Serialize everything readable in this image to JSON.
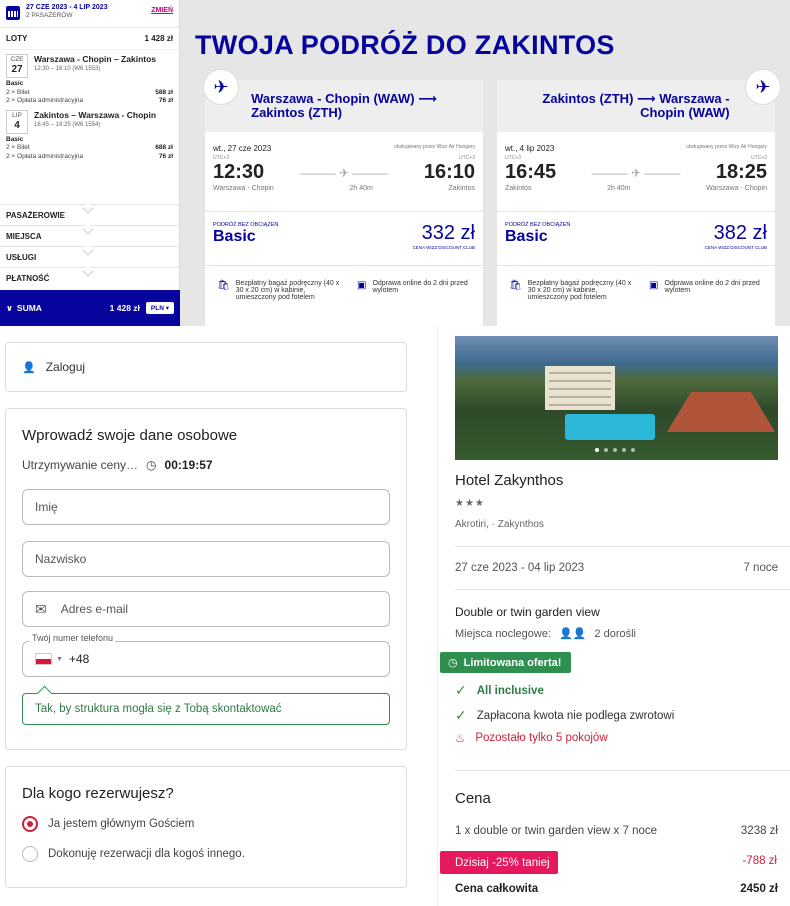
{
  "flight_summary": {
    "dates": "27 CZE 2023 - 4 LIP 2023",
    "passengers": "2 PASAŻERÓW",
    "change_label": "ZMIEŃ",
    "flights_label": "LOTY",
    "flights_total": "1 428 zł",
    "outbound": {
      "month": "CZE",
      "day": "27",
      "route": "Warszawa - Chopin – Zakintos",
      "time": "12:30 – 16:10 (W6 1553)",
      "fare_name": "Basic",
      "lines": [
        {
          "label": "2 × Bilet",
          "price": "588 zł"
        },
        {
          "label": "2 × Opłata administracyjna",
          "price": "76 zł"
        }
      ]
    },
    "inbound": {
      "month": "LIP",
      "day": "4",
      "route": "Zakintos – Warszawa - Chopin",
      "time": "16:45 – 18:25 (W6 1554)",
      "fare_name": "Basic",
      "lines": [
        {
          "label": "2 × Bilet",
          "price": "688 zł"
        },
        {
          "label": "2 × Opłata administracyjna",
          "price": "76 zł"
        }
      ]
    },
    "sections": [
      "PASAŻEROWIE",
      "MIEJSCA",
      "USŁUGI",
      "PŁATNOŚĆ"
    ],
    "sum_label": "SUMA",
    "sum_value": "1 428 zł",
    "currency": "PLN"
  },
  "trip_title": "TWOJA PODRÓŻ DO ZAKINTOS",
  "cards": [
    {
      "route_line1": "Warszawa - Chopin (WAW) ⟶",
      "route_line2": "Zakintos (ZTH)",
      "date": "wt., 27 cze 2023",
      "operator": "obsługiwany przez Wizz Air Hungary",
      "utc_dep": "UTC+2",
      "utc_arr": "UTC+3",
      "dep_time": "12:30",
      "arr_time": "16:10",
      "duration": "2h 40m",
      "dep_place": "Warszawa - Chopin",
      "arr_place": "Zakintos",
      "fare_label": "PODRÓŻ BEZ OBCIĄŻEŃ",
      "fare_name": "Basic",
      "price": "332 zł",
      "club": "CENA WIZZ DISCOUNT CLUB",
      "bag_text": "Bezpłatny bagaż podręczny (40 x 30 x 20 cm) w kabinie, umieszczony pod fotelem",
      "checkin_text": "Odprawa online do 2 dni przed wylotem"
    },
    {
      "route_line1": "Zakintos (ZTH) ⟶ Warszawa -",
      "route_line2": "Chopin (WAW)",
      "date": "wt., 4 lip 2023",
      "operator": "obsługiwany przez Wizz Air Hungary",
      "utc_dep": "UTC+3",
      "utc_arr": "UTC+2",
      "dep_time": "16:45",
      "arr_time": "18:25",
      "duration": "2h 40m",
      "dep_place": "Zakintos",
      "arr_place": "Warszawa - Chopin",
      "fare_label": "PODRÓŻ BEZ OBCIĄŻEŃ",
      "fare_name": "Basic",
      "price": "382 zł",
      "club": "CENA WIZZ DISCOUNT CLUB",
      "bag_text": "Bezpłatny bagaż podręczny (40 x 30 x 20 cm) w kabinie, umieszczony pod fotelem",
      "checkin_text": "Odprawa online do 2 dni przed wylotem"
    }
  ],
  "login": {
    "label": "Zaloguj"
  },
  "form": {
    "title": "Wprowadź swoje dane osobowe",
    "hold_label": "Utrzymywanie ceny…",
    "hold_timer": "00:19:57",
    "first_name_placeholder": "Imię",
    "last_name_placeholder": "Nazwisko",
    "email_placeholder": "Adres e-mail",
    "phone_label": "Twój numer telefonu",
    "phone_prefix": "+48",
    "hint": "Tak, by struktura mogła się z Tobą skontaktować"
  },
  "who": {
    "title": "Dla kogo rezerwujesz?",
    "option1": "Ja jestem głównym Gościem",
    "option2": "Dokonuję rezerwacji dla kogoś innego."
  },
  "hotel": {
    "name": "Hotel Zakynthos",
    "stars": "★★★",
    "location": "Akrotiri, · Zakynthos",
    "dates": "27 cze 2023 - 04 lip 2023",
    "nights": "7 noce",
    "room": "Double or twin garden view",
    "beds_label": "Miejsca noclegowe:",
    "guests": "2 dorośli",
    "limited": "Limitowana oferta!",
    "perks": [
      "All inclusive",
      "Zapłacona kwota nie podlega zwrotowi"
    ],
    "rooms_left": "Pozostało tylko 5 pokojów",
    "price_title": "Cena",
    "price_line_label": "1 x double or twin garden view x 7 noce",
    "price_line_value": "3238 zł",
    "discount_label": "Dzisiaj -25% taniej",
    "discount_value": "-788 zł",
    "total_label": "Cena całkowita",
    "total_value": "2450 zł"
  },
  "colors": {
    "wizz_blue": "#06049c",
    "wizz_pink": "#c6007e",
    "green": "#2f8f4e",
    "red": "#d11f3a",
    "discount_pink": "#e5195e"
  }
}
